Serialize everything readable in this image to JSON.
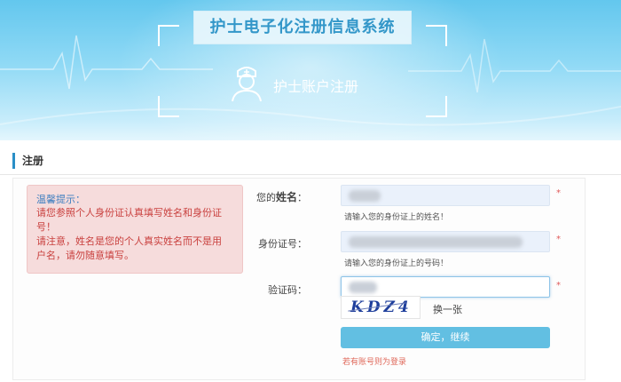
{
  "banner": {
    "system_title": "护士电子化注册信息系统",
    "subtitle": "护士账户注册"
  },
  "section": {
    "title": "注册"
  },
  "tip": {
    "title": "温馨提示：",
    "lines": [
      "请您参照个人身份证认真填写姓名和身份证",
      "号！",
      "请注意，姓名是您的个人真实姓名而不是用",
      "户名，请勿随意填写。"
    ]
  },
  "form": {
    "name_label_prefix": "您的",
    "name_label_bold": "姓名",
    "name_label_suffix": "：",
    "name_hint": "请输入您的身份证上的姓名！",
    "id_label": "身份证号：",
    "id_hint": "请输入您的身份证上的号码！",
    "captcha_label": "验证码：",
    "captcha_text": "KDZ4",
    "refresh_label": "换一张",
    "submit_label": "确定，继续",
    "login_link": "若有账号则为登录",
    "required_mark": "*"
  },
  "colors": {
    "banner_top": "#63c7ee",
    "title_text": "#3397c9",
    "tip_background": "#f6dcdc",
    "tip_text": "#c9413f",
    "submit_background": "#62bfe2",
    "required": "#e05a5a"
  }
}
